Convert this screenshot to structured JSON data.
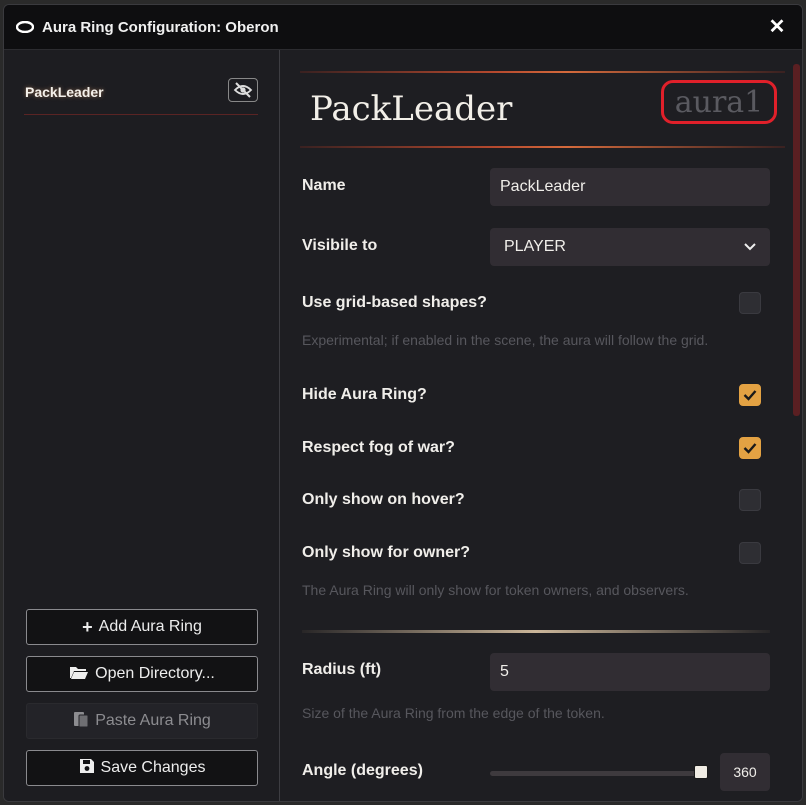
{
  "window": {
    "title": "Aura Ring Configuration: Oberon",
    "close_glyph": "✕"
  },
  "sidebar": {
    "rings": [
      {
        "label": "PackLeader",
        "visibility_icon": "eye-slash-icon"
      }
    ],
    "buttons": {
      "add": {
        "icon": "+",
        "label": "Add Aura Ring"
      },
      "open": {
        "icon": "📂",
        "label": "Open Directory..."
      },
      "paste": {
        "icon": "📋",
        "label": "Paste Aura Ring"
      },
      "save": {
        "icon": "💾",
        "label": "Save Changes"
      }
    }
  },
  "editor": {
    "heading": "PackLeader",
    "aura_id": "aura1",
    "name": {
      "label": "Name",
      "value": "PackLeader"
    },
    "visible_to": {
      "label": "Visibile to",
      "value": "PLAYER",
      "chevron": "⌄"
    },
    "grid_shapes": {
      "label": "Use grid-based shapes?",
      "checked": false,
      "hint": "Experimental; if enabled in the scene, the aura will follow the grid."
    },
    "hide_ring": {
      "label": "Hide Aura Ring?",
      "checked": true
    },
    "fog_of_war": {
      "label": "Respect fog of war?",
      "checked": true
    },
    "hover": {
      "label": "Only show on hover?",
      "checked": false
    },
    "owner": {
      "label": "Only show for owner?",
      "checked": false,
      "hint": "The Aura Ring will only show for token owners, and observers."
    },
    "radius": {
      "label": "Radius (ft)",
      "value": "5",
      "hint": "Size of the Aura Ring from the edge of the token."
    },
    "angle": {
      "label": "Angle (degrees)",
      "value": "360",
      "fraction": 1.0
    }
  },
  "colors": {
    "accent": "#e3a243",
    "highlight": "#e0202a"
  }
}
